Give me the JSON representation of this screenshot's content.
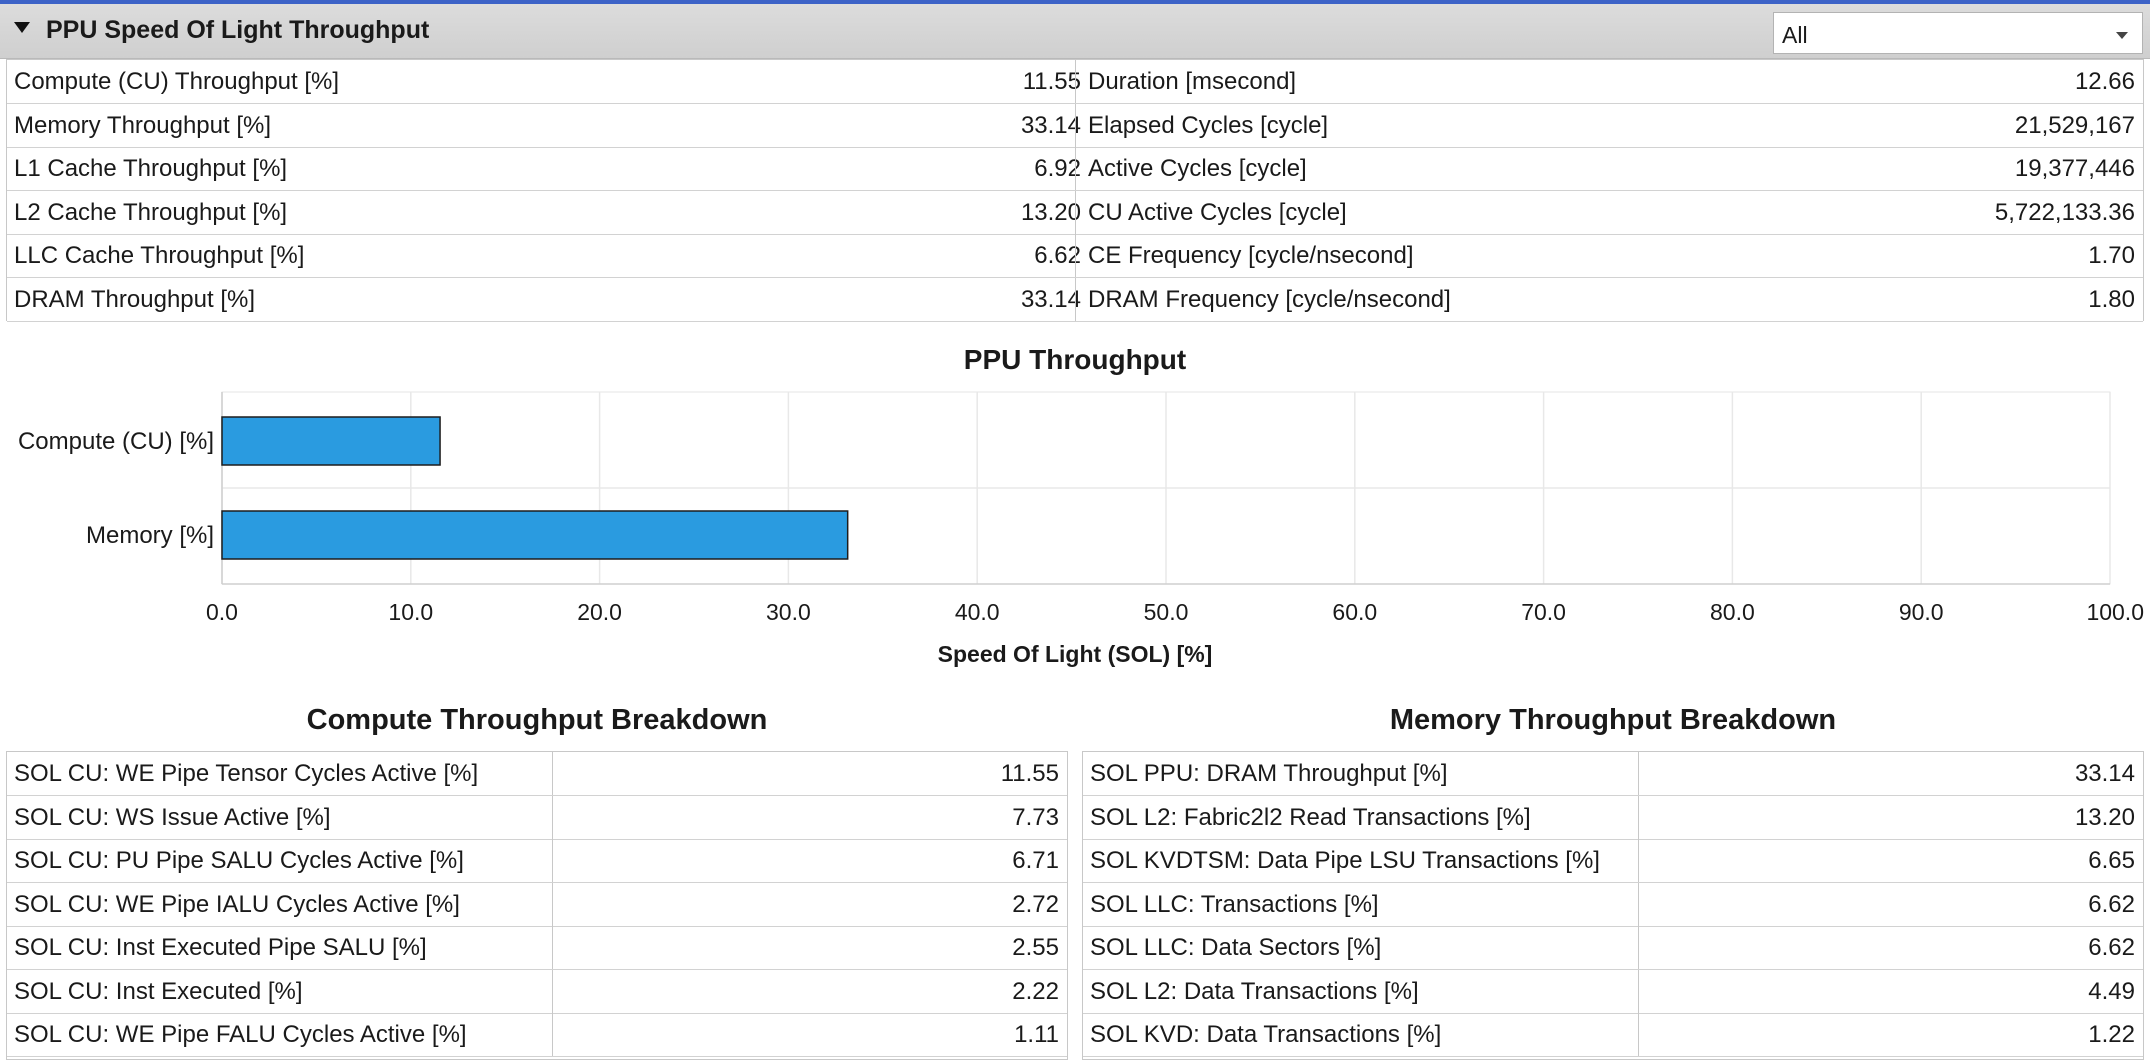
{
  "section": {
    "title": "PPU Speed Of Light Throughput",
    "filter_value": "All"
  },
  "sol_metrics": {
    "left": [
      {
        "label": "Compute (CU) Throughput [%]",
        "value": "11.55"
      },
      {
        "label": "Memory Throughput [%]",
        "value": "33.14"
      },
      {
        "label": "L1 Cache Throughput [%]",
        "value": "6.92"
      },
      {
        "label": "L2 Cache Throughput [%]",
        "value": "13.20"
      },
      {
        "label": "LLC Cache Throughput [%]",
        "value": "6.62"
      },
      {
        "label": "DRAM Throughput [%]",
        "value": "33.14"
      }
    ],
    "right": [
      {
        "label": "Duration [msecond]",
        "value": "12.66"
      },
      {
        "label": "Elapsed Cycles [cycle]",
        "value": "21,529,167"
      },
      {
        "label": "Active Cycles [cycle]",
        "value": "19,377,446"
      },
      {
        "label": "CU Active Cycles [cycle]",
        "value": "5,722,133.36"
      },
      {
        "label": "CE Frequency [cycle/nsecond]",
        "value": "1.70"
      },
      {
        "label": "DRAM Frequency [cycle/nsecond]",
        "value": "1.80"
      }
    ]
  },
  "chart_data": {
    "type": "bar",
    "orientation": "horizontal",
    "title": "PPU Throughput",
    "xlabel": "Speed Of Light (SOL) [%]",
    "ylabel": "",
    "categories": [
      "Compute (CU) [%]",
      "Memory [%]"
    ],
    "values": [
      11.55,
      33.14
    ],
    "xlim": [
      0,
      100
    ],
    "xticks": [
      "0.0",
      "10.0",
      "20.0",
      "30.0",
      "40.0",
      "50.0",
      "60.0",
      "70.0",
      "80.0",
      "90.0",
      "100.0"
    ],
    "grid": true,
    "bar_color": "#2a9be0"
  },
  "compute_breakdown": {
    "title": "Compute Throughput Breakdown",
    "rows": [
      {
        "label": "SOL CU: WE Pipe Tensor Cycles Active [%]",
        "value": "11.55"
      },
      {
        "label": "SOL CU: WS Issue Active [%]",
        "value": "7.73"
      },
      {
        "label": "SOL CU: PU Pipe SALU Cycles Active [%]",
        "value": "6.71"
      },
      {
        "label": "SOL CU: WE Pipe IALU Cycles Active [%]",
        "value": "2.72"
      },
      {
        "label": "SOL CU: Inst Executed Pipe SALU [%]",
        "value": "2.55"
      },
      {
        "label": "SOL CU: Inst Executed [%]",
        "value": "2.22"
      },
      {
        "label": "SOL CU: WE Pipe FALU Cycles Active [%]",
        "value": "1.11"
      }
    ]
  },
  "memory_breakdown": {
    "title": "Memory Throughput Breakdown",
    "rows": [
      {
        "label": "SOL PPU: DRAM Throughput [%]",
        "value": "33.14"
      },
      {
        "label": "SOL L2: Fabric2l2 Read Transactions [%]",
        "value": "13.20"
      },
      {
        "label": "SOL KVDTSM: Data Pipe LSU Transactions [%]",
        "value": "6.65"
      },
      {
        "label": "SOL LLC: Transactions [%]",
        "value": "6.62"
      },
      {
        "label": "SOL LLC: Data Sectors [%]",
        "value": "6.62"
      },
      {
        "label": "SOL L2: Data Transactions [%]",
        "value": "4.49"
      },
      {
        "label": "SOL KVD: Data Transactions [%]",
        "value": "1.22"
      }
    ]
  }
}
